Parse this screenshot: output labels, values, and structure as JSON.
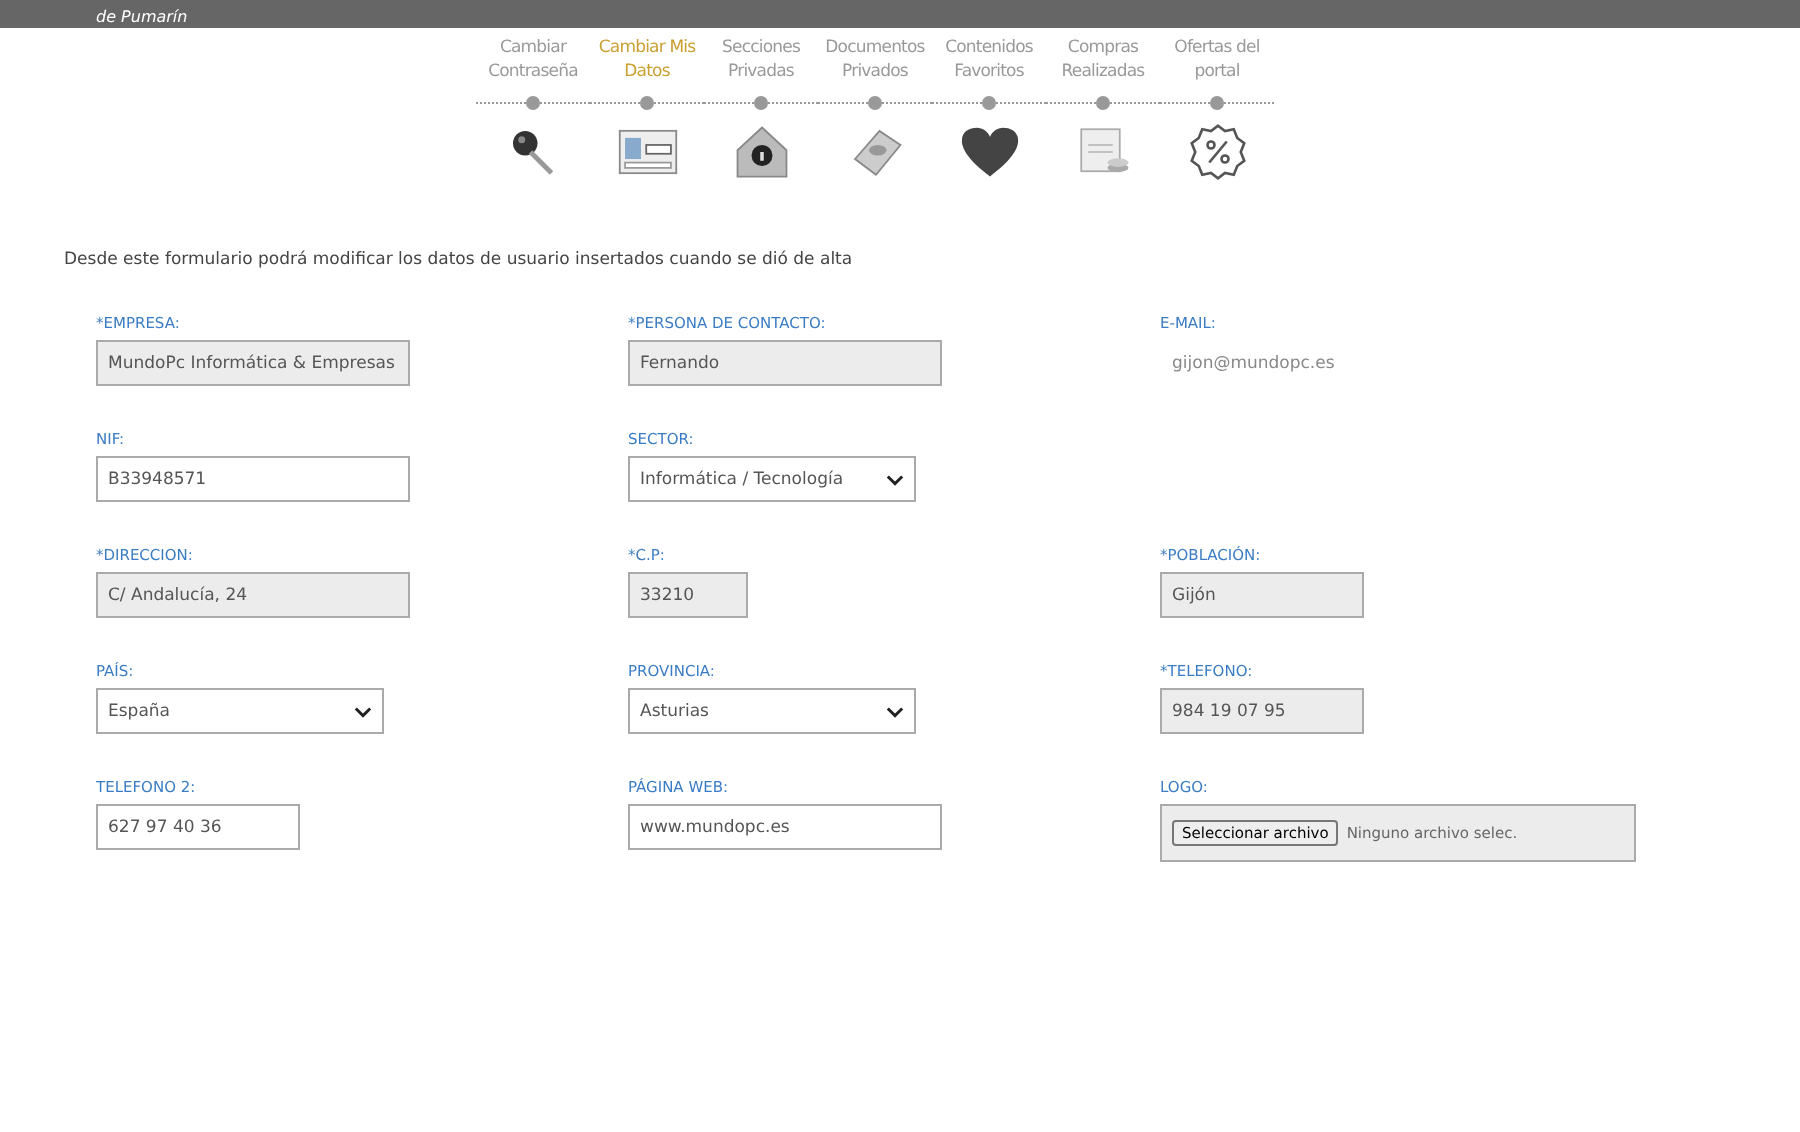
{
  "header": {
    "logo_text": "de Pumarín"
  },
  "steps": [
    {
      "label": "Cambiar Contraseña",
      "selected": false
    },
    {
      "label": "Cambiar Mis Datos",
      "selected": true
    },
    {
      "label": "Secciones Privadas",
      "selected": false
    },
    {
      "label": "Documentos Privados",
      "selected": false
    },
    {
      "label": "Contenidos Favoritos",
      "selected": false
    },
    {
      "label": "Compras Realizadas",
      "selected": false
    },
    {
      "label": "Ofertas del portal",
      "selected": false
    }
  ],
  "intro": "Desde este formulario podrá modificar los datos de usuario insertados cuando se dió de alta",
  "rows": [
    [
      {
        "label": "*EMPRESA:",
        "kind": "readonly",
        "value": "MundoPc Informática & Empresas"
      },
      {
        "label": "*PERSONA DE CONTACTO:",
        "kind": "readonly",
        "value": "Fernando"
      },
      {
        "label": "E-MAIL:",
        "kind": "text",
        "value": "gijon@mundopc.es"
      }
    ],
    [
      {
        "label": "NIF:",
        "kind": "input",
        "value": "B33948571"
      },
      {
        "label": "SECTOR:",
        "kind": "select",
        "value": "Informática / Tecnología"
      }
    ],
    [
      {
        "label": "*DIRECCION:",
        "kind": "readonly",
        "value": "C/ Andalucía, 24"
      },
      {
        "label": "*C.P:",
        "kind": "readonly",
        "value": "33210"
      },
      {
        "label": "*POBLACIÓN:",
        "kind": "readonly",
        "value": "Gijón"
      }
    ],
    [
      {
        "label": "PAÍS:",
        "kind": "select",
        "value": "España"
      },
      {
        "label": "PROVINCIA:",
        "kind": "select",
        "value": "Asturias"
      },
      {
        "label": "*TELEFONO:",
        "kind": "readonly",
        "value": "984 19 07 95"
      }
    ],
    [
      {
        "label": "TELEFONO 2:",
        "kind": "input",
        "value": "627 97 40 36"
      },
      {
        "label": "PÁGINA WEB:",
        "kind": "input",
        "value": "www.mundopc.es"
      },
      {
        "label": "LOGO:",
        "kind": "file",
        "button": "Seleccionar archivo",
        "value": "Ninguno archivo selec."
      }
    ]
  ]
}
